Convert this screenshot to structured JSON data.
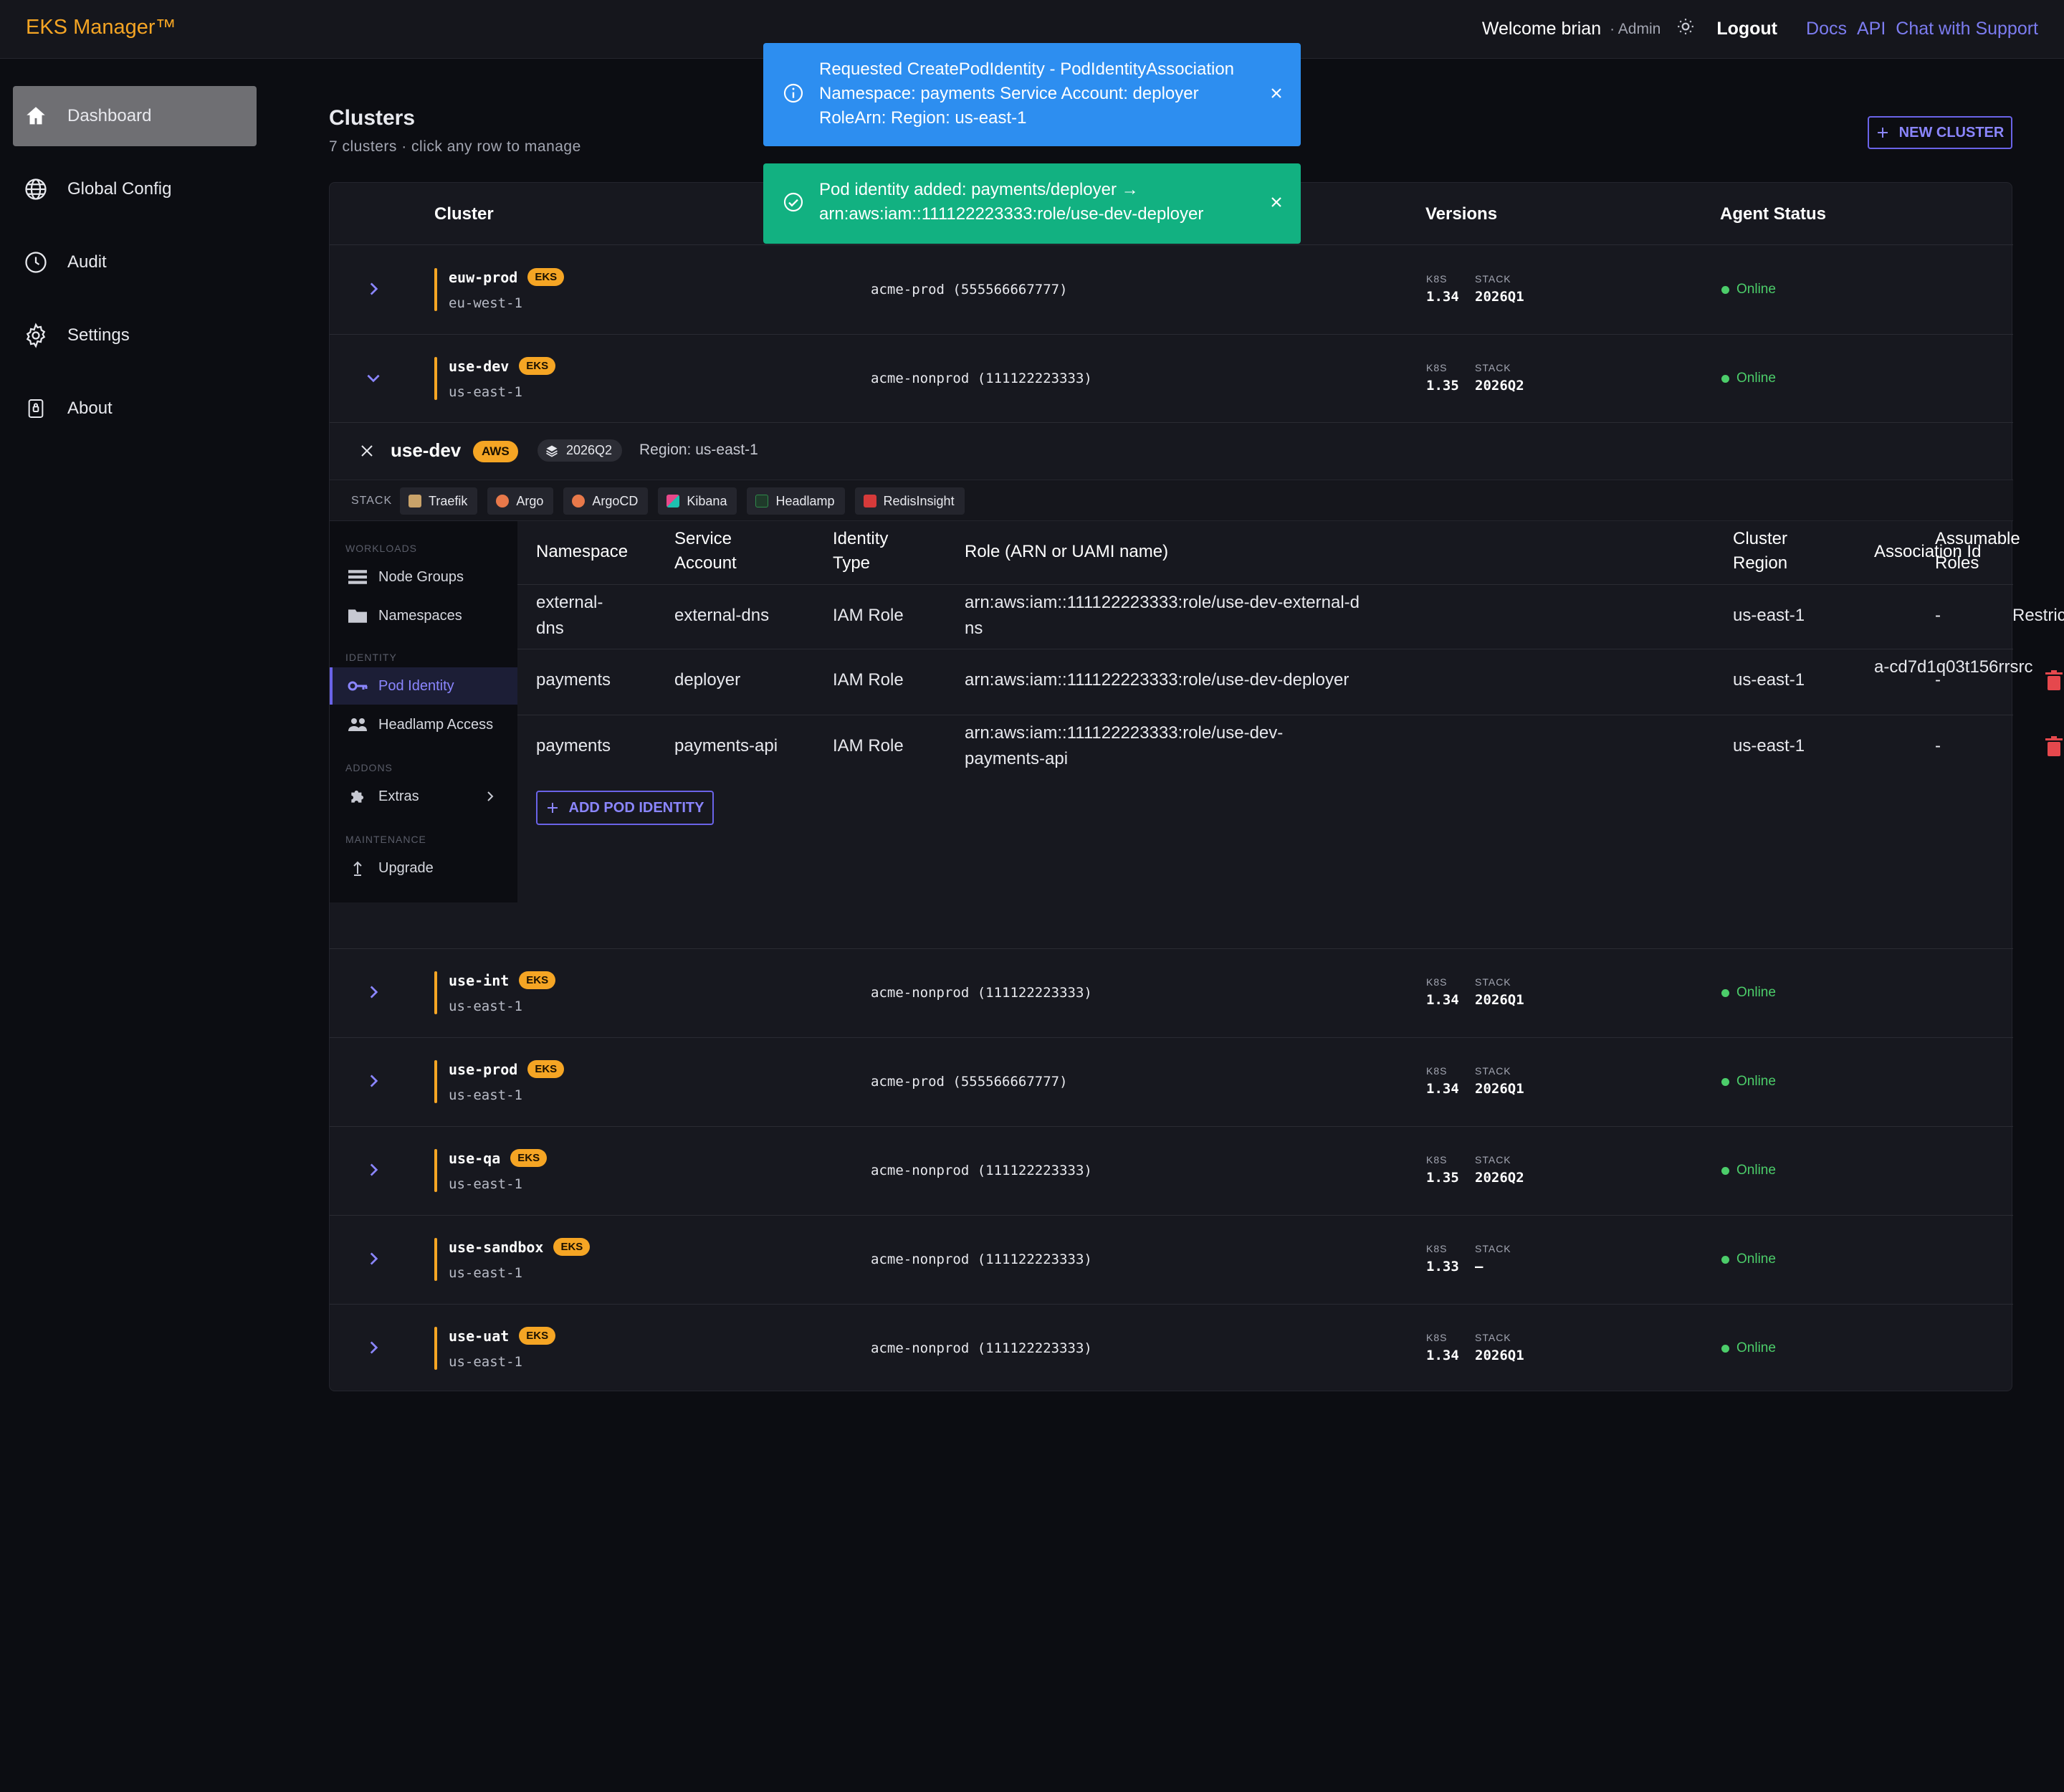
{
  "header": {
    "brand": "EKS Manager™",
    "welcome": "Welcome brian",
    "role": "· Admin",
    "logout": "Logout",
    "links": [
      "Docs",
      "API",
      "Chat with Support"
    ]
  },
  "sidebar": {
    "items": [
      {
        "label": "Dashboard",
        "icon": "home-icon",
        "active": true
      },
      {
        "label": "Global Config",
        "icon": "globe-icon"
      },
      {
        "label": "Audit",
        "icon": "clock-icon"
      },
      {
        "label": "Settings",
        "icon": "gear-icon"
      },
      {
        "label": "About",
        "icon": "lock-icon"
      }
    ]
  },
  "main": {
    "title": "Clusters",
    "subtitle": "7 clusters · click any row to manage",
    "new_cluster": "NEW CLUSTER",
    "columns": [
      "Cluster",
      "Versions",
      "Agent Status"
    ],
    "version_labels": {
      "k8s": "K8S",
      "stack": "STACK"
    }
  },
  "clusters": [
    {
      "name": "euw-prod",
      "badge": "EKS",
      "region": "eu-west-1",
      "account": "acme-prod (555566667777)",
      "k8s": "1.34",
      "stack": "2026Q1",
      "status": "Online"
    },
    {
      "name": "use-dev",
      "badge": "EKS",
      "region": "us-east-1",
      "account": "acme-nonprod (111122223333)",
      "k8s": "1.35",
      "stack": "2026Q2",
      "status": "Online"
    },
    {
      "name": "use-int",
      "badge": "EKS",
      "region": "us-east-1",
      "account": "acme-nonprod (111122223333)",
      "k8s": "1.34",
      "stack": "2026Q1",
      "status": "Online"
    },
    {
      "name": "use-prod",
      "badge": "EKS",
      "region": "us-east-1",
      "account": "acme-prod (555566667777)",
      "k8s": "1.34",
      "stack": "2026Q1",
      "status": "Online"
    },
    {
      "name": "use-qa",
      "badge": "EKS",
      "region": "us-east-1",
      "account": "acme-nonprod (111122223333)",
      "k8s": "1.35",
      "stack": "2026Q2",
      "status": "Online"
    },
    {
      "name": "use-sandbox",
      "badge": "EKS",
      "region": "us-east-1",
      "account": "acme-nonprod (111122223333)",
      "k8s": "1.33",
      "stack": "–",
      "status": "Online"
    },
    {
      "name": "use-uat",
      "badge": "EKS",
      "region": "us-east-1",
      "account": "acme-nonprod (111122223333)",
      "k8s": "1.34",
      "stack": "2026Q1",
      "status": "Online"
    }
  ],
  "detail": {
    "name": "use-dev",
    "provider": "AWS",
    "stack": "2026Q2",
    "region": "Region: us-east-1",
    "stack_label": "STACK",
    "stack_items": [
      {
        "label": "Traefik",
        "color": "#c9a36a"
      },
      {
        "label": "Argo",
        "color": "#e8794a"
      },
      {
        "label": "ArgoCD",
        "color": "#e8794a"
      },
      {
        "label": "Kibana",
        "color": "#e8488a"
      },
      {
        "label": "Headlamp",
        "color": "#2f8a4a"
      },
      {
        "label": "RedisInsight",
        "color": "#d63a3a"
      }
    ],
    "menu": {
      "workloads": "WORKLOADS",
      "node_groups": "Node Groups",
      "namespaces": "Namespaces",
      "identity": "IDENTITY",
      "pod_identity": "Pod Identity",
      "headlamp_access": "Headlamp Access",
      "addons": "ADDONS",
      "extras": "Extras",
      "maintenance": "MAINTENANCE",
      "upgrade": "Upgrade"
    },
    "pod_identity": {
      "headers": [
        "Namespace",
        "Service Account",
        "Identity Type",
        "Role (ARN or UAMI name)",
        "Cluster Region",
        "Association Id",
        "Assumable Roles"
      ],
      "rows": [
        {
          "namespace": "external-dns",
          "service_account": "external-dns",
          "identity_type": "IAM Role",
          "role": "arn:aws:iam::111122223333:role/use-dev-external-dns",
          "region": "us-east-1",
          "association_id": "",
          "assumable_roles": "-",
          "action": "Restricted"
        },
        {
          "namespace": "payments",
          "service_account": "deployer",
          "identity_type": "IAM Role",
          "role": "arn:aws:iam::111122223333:role/use-dev-deployer",
          "region": "us-east-1",
          "association_id": "a-cd7d1q03t156rrsrc",
          "assumable_roles": "-",
          "action": "delete"
        },
        {
          "namespace": "payments",
          "service_account": "payments-api",
          "identity_type": "IAM Role",
          "role": "arn:aws:iam::111122223333:role/use-dev-payments-api",
          "region": "us-east-1",
          "association_id": "",
          "assumable_roles": "-",
          "action": "delete"
        }
      ],
      "add_button": "ADD POD IDENTITY"
    }
  },
  "toasts": [
    {
      "type": "info",
      "text": "Requested CreatePodIdentity - PodIdentityAssociation Namespace: payments Service Account: deployer RoleArn: Region: us-east-1"
    },
    {
      "type": "success",
      "text": "Pod identity added: payments/deployer → arn:aws:iam::111122223333:role/use-dev-deployer"
    }
  ],
  "colors": {
    "accent": "#f5a524",
    "primary": "#6a63e8",
    "online": "#4ccd6a",
    "info": "#2d8ef0",
    "success": "#12b181",
    "danger": "#e5484d"
  }
}
